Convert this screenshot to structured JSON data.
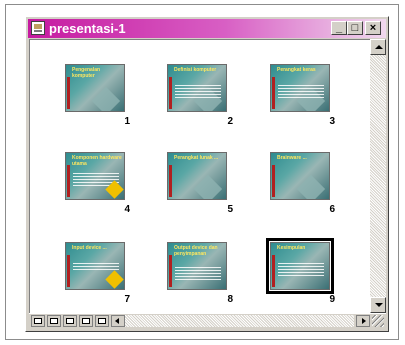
{
  "window": {
    "title": "presentasi-1",
    "buttons": {
      "minimize": "_",
      "maximize": "□",
      "close": "×"
    }
  },
  "slides": [
    {
      "number": "1",
      "title": "Pengenalan komputer"
    },
    {
      "number": "2",
      "title": "Definisi komputer"
    },
    {
      "number": "3",
      "title": "Perangkat keras"
    },
    {
      "number": "4",
      "title": "Komponen hardware utama"
    },
    {
      "number": "5",
      "title": "Perangkat lunak ..."
    },
    {
      "number": "6",
      "title": "Brainware ..."
    },
    {
      "number": "7",
      "title": "Input device ..."
    },
    {
      "number": "8",
      "title": "Output device dan penyimpanan"
    },
    {
      "number": "9",
      "title": "Kesimpulan"
    }
  ],
  "selected_slide": "9",
  "view_buttons": [
    "normal-view",
    "outline-view",
    "slide-sorter-view",
    "notes-view",
    "slideshow-view"
  ],
  "colors": {
    "titlebar_start": "#c61aa0",
    "slide_bg": "#2f8c8f",
    "slide_title": "#ffe860",
    "accent_red": "#b02020"
  }
}
